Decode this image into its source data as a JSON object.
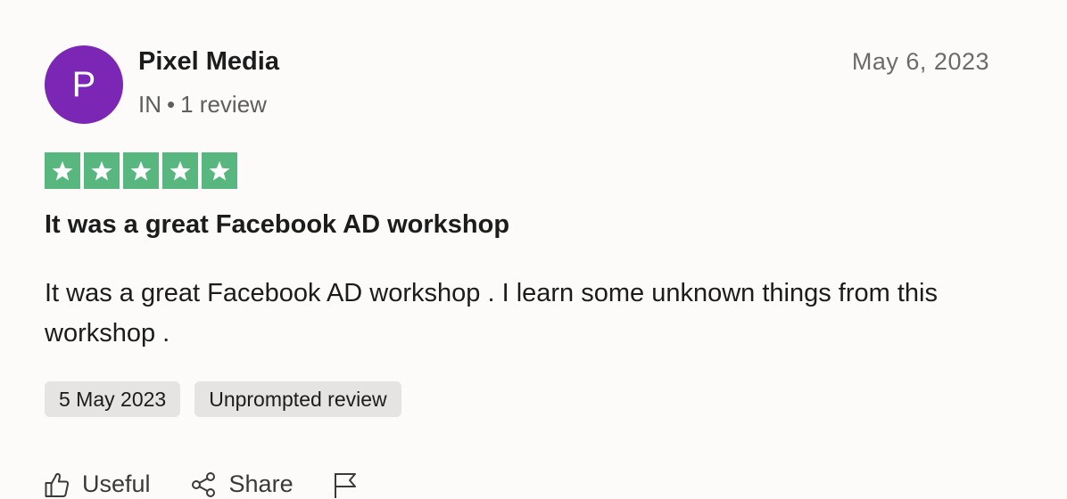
{
  "reviewer": {
    "initial": "P",
    "name": "Pixel Media",
    "country": "IN",
    "separator": "•",
    "review_count": "1 review",
    "avatar_color": "#7b26b4"
  },
  "review": {
    "date": "May 6, 2023",
    "rating": 5,
    "max_rating": 5,
    "star_color": "#57b77e",
    "title": "It was a great Facebook AD workshop",
    "body": "It was a great Facebook AD workshop . I learn some unknown things from this workshop .",
    "tags": {
      "experience_date": "5 May 2023",
      "source": "Unprompted review"
    }
  },
  "actions": {
    "useful_label": "Useful",
    "share_label": "Share",
    "useful_icon": "thumbs-up-icon",
    "share_icon": "share-icon",
    "report_icon": "flag-icon"
  }
}
